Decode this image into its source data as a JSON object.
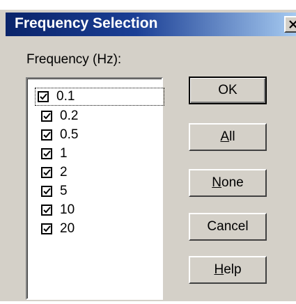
{
  "window": {
    "title": "Frequency Selection"
  },
  "list": {
    "label": "Frequency (Hz):",
    "items": [
      {
        "label": "0.1",
        "checked": true
      },
      {
        "label": "0.2",
        "checked": true
      },
      {
        "label": "0.5",
        "checked": true
      },
      {
        "label": "1",
        "checked": true
      },
      {
        "label": "2",
        "checked": true
      },
      {
        "label": "5",
        "checked": true
      },
      {
        "label": "10",
        "checked": true
      },
      {
        "label": "20",
        "checked": true
      }
    ]
  },
  "buttons": {
    "ok": "OK",
    "all_mnemonic": "A",
    "all_rest": "ll",
    "none_mnemonic": "N",
    "none_rest": "one",
    "cancel": "Cancel",
    "help_mnemonic": "H",
    "help_rest": "elp"
  },
  "icons": {
    "close": "close-icon",
    "check": "check-icon"
  }
}
